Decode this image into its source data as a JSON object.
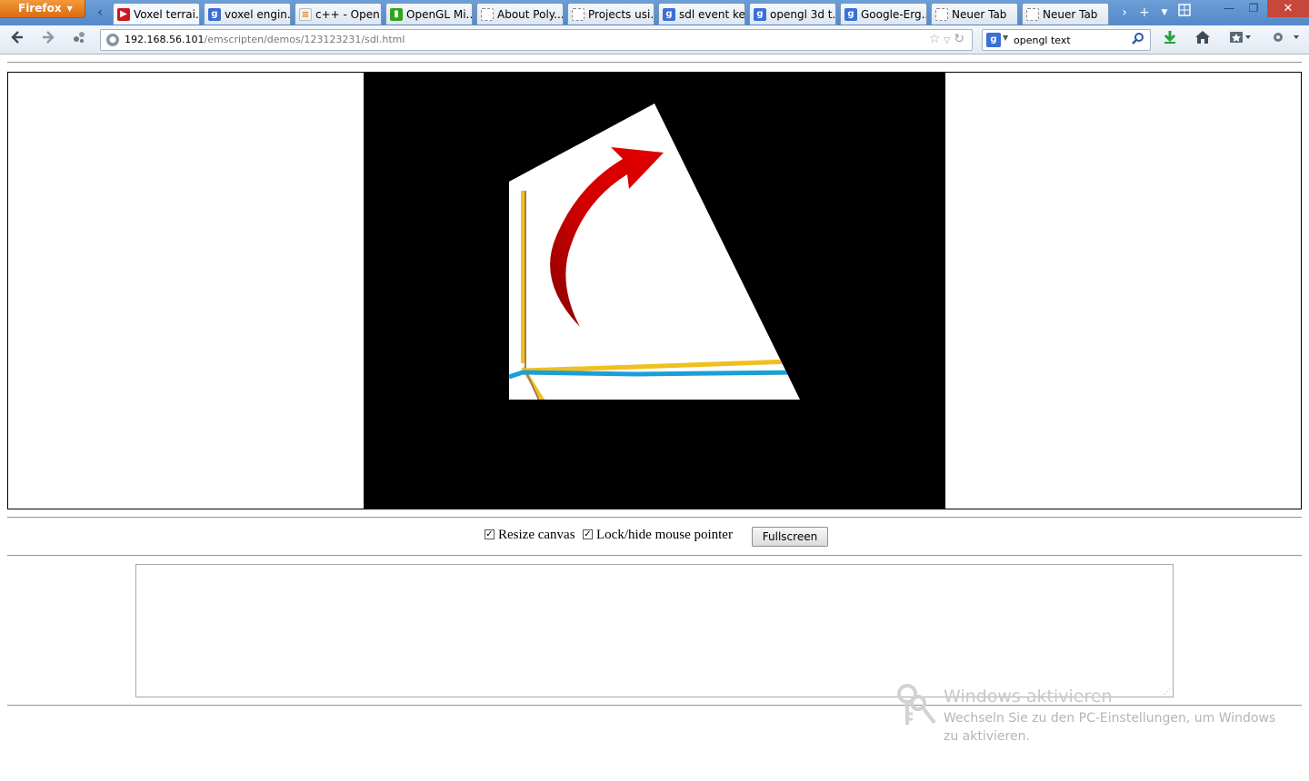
{
  "browser": {
    "menu_button": "Firefox",
    "tabs": [
      {
        "label": "Voxel terrai...",
        "icon": "youtube-icon"
      },
      {
        "label": "voxel engin...",
        "icon": "google-icon"
      },
      {
        "label": "c++ - Open...",
        "icon": "stackoverflow-icon"
      },
      {
        "label": "OpenGL Mi...",
        "icon": "opengl-icon"
      },
      {
        "label": "About Poly...",
        "icon": "blank-page-icon"
      },
      {
        "label": "Projects usi...",
        "icon": "blank-page-icon"
      },
      {
        "label": "sdl event ke...",
        "icon": "google-icon"
      },
      {
        "label": "opengl 3d t...",
        "icon": "google-icon"
      },
      {
        "label": "Google-Erg...",
        "icon": "google-icon"
      },
      {
        "label": "Neuer Tab",
        "icon": "blank-page-icon"
      },
      {
        "label": "Neuer Tab",
        "icon": "blank-page-icon"
      }
    ],
    "url_host": "192.168.56.101",
    "url_path": "/emscripten/demos/123123231/sdl.html",
    "search_value": "opengl text",
    "search_engine_icon": "google-icon"
  },
  "page": {
    "resize_canvas_label": "Resize canvas",
    "resize_canvas_checked": true,
    "lock_pointer_label": "Lock/hide mouse pointer",
    "lock_pointer_checked": true,
    "fullscreen_label": "Fullscreen",
    "output_text": ""
  },
  "watermark": {
    "title": "Windows aktivieren",
    "line1": "Wechseln Sie zu den PC-Einstellungen, um Windows",
    "line2": "zu aktivieren."
  },
  "colors": {
    "canvas_bg": "#000000",
    "arrow_red": "#c80000",
    "line_yellow": "#f0c020",
    "line_blue": "#1a9fd8",
    "firefox_orange": "#e07a16"
  }
}
